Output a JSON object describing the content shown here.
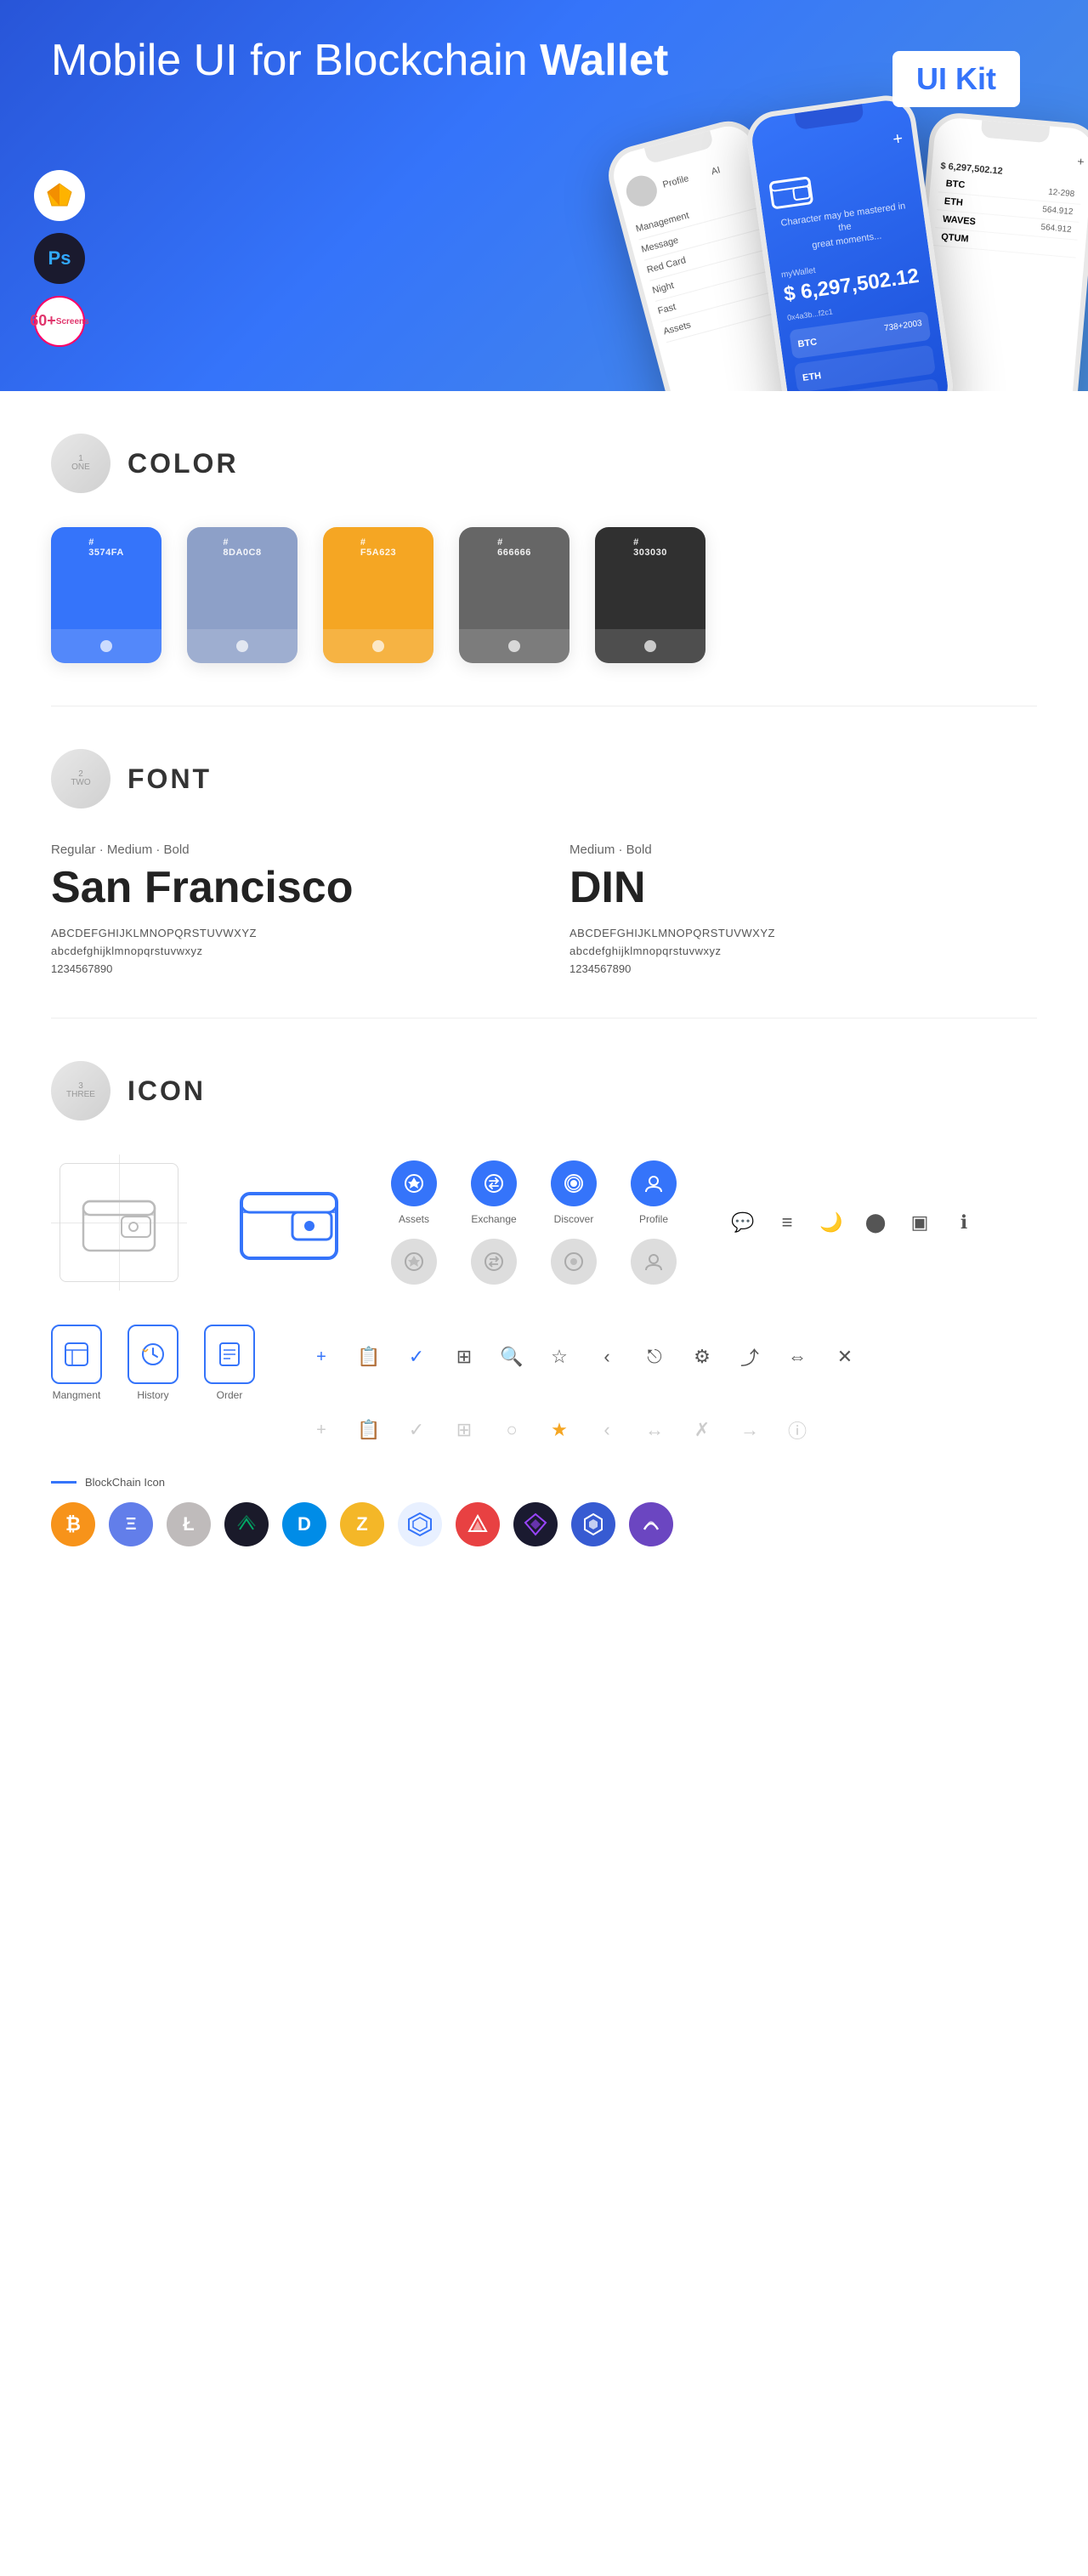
{
  "hero": {
    "title_light": "Mobile UI for Blockchain ",
    "title_bold": "Wallet",
    "badge": "UI Kit",
    "badge_sketch": "sketch",
    "badge_ps": "Ps",
    "badge_screens": "60+\nScreens"
  },
  "sections": {
    "color": {
      "number": "1",
      "sub": "ONE",
      "title": "COLOR",
      "swatches": [
        {
          "hex": "#3574FA",
          "label": "#\n3574FA",
          "bg": "#3574FA"
        },
        {
          "hex": "#8D A0C8",
          "label": "#\n8DA0C8",
          "bg": "#8DA0C8"
        },
        {
          "hex": "#F5A623",
          "label": "#\nF5A623",
          "bg": "#F5A623"
        },
        {
          "hex": "#666666",
          "label": "#\n666666",
          "bg": "#666666"
        },
        {
          "hex": "#303030",
          "label": "#\n303030",
          "bg": "#303030"
        }
      ]
    },
    "font": {
      "number": "2",
      "sub": "TWO",
      "title": "FONT",
      "fonts": [
        {
          "label": "Regular · Medium · Bold",
          "name": "San Francisco",
          "upper": "ABCDEFGHIJKLMNOPQRSTUVWXYZ",
          "lower": "abcdefghijklmnopqrstuvwxyz",
          "nums": "1234567890"
        },
        {
          "label": "Medium · Bold",
          "name": "DIN",
          "upper": "ABCDEFGHIJKLMNOPQRSTUVWXYZ",
          "lower": "abcdefghijklmnopqrstuvwxyz",
          "nums": "1234567890"
        }
      ]
    },
    "icon": {
      "number": "3",
      "sub": "THREE",
      "title": "ICON",
      "nav_items": [
        {
          "label": "Assets",
          "color": "blue"
        },
        {
          "label": "Exchange",
          "color": "blue"
        },
        {
          "label": "Discover",
          "color": "blue"
        },
        {
          "label": "Profile",
          "color": "blue"
        },
        {
          "label": "",
          "color": "gray"
        },
        {
          "label": "",
          "color": "gray"
        },
        {
          "label": "",
          "color": "gray"
        },
        {
          "label": "",
          "color": "gray"
        }
      ],
      "app_items": [
        {
          "label": "Mangment"
        },
        {
          "label": "History"
        },
        {
          "label": "Order"
        }
      ],
      "blockchain_label": "BlockChain Icon",
      "crypto_icons": [
        {
          "symbol": "₿",
          "bg": "#F7931A",
          "color": "#fff"
        },
        {
          "symbol": "Ξ",
          "bg": "#627EEA",
          "color": "#fff"
        },
        {
          "symbol": "Ł",
          "bg": "#A6A9AA",
          "color": "#fff"
        },
        {
          "symbol": "◈",
          "bg": "#1B1B2E",
          "color": "#5a5"
        },
        {
          "symbol": "◎",
          "bg": "#006AD9",
          "color": "#fff"
        },
        {
          "symbol": "Z",
          "bg": "#F4B728",
          "color": "#fff"
        },
        {
          "symbol": "⬡",
          "bg": "#3B82F6",
          "color": "#fff"
        },
        {
          "symbol": "▲",
          "bg": "#E84142",
          "color": "#fff"
        },
        {
          "symbol": "◆",
          "bg": "#2B2B2B",
          "color": "#a0f"
        },
        {
          "symbol": "∞",
          "bg": "#F5A623",
          "color": "#fff"
        },
        {
          "symbol": "~",
          "bg": "#3574FA",
          "color": "#fff"
        }
      ]
    }
  }
}
